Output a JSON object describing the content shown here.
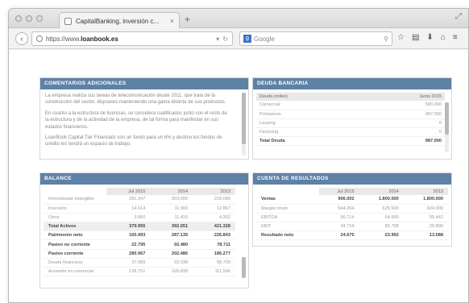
{
  "browser": {
    "tab_title": "CapitalBanking, inversión c...",
    "tab_close": "×",
    "new_tab": "+",
    "url_prefix": "https://www.",
    "url_domain": "loanbook.es",
    "reload": "↻",
    "search_placeholder": "Google",
    "search_engine_icon": "google-icon",
    "back_icon": "back-arrow-icon",
    "tool_icons": [
      "star-icon",
      "reading-list-icon",
      "download-icon",
      "home-icon",
      "menu-icon"
    ]
  },
  "panels": {
    "additional_comments": {
      "title": "COMENTARIOS ADICIONALES",
      "paragraphs": [
        "La empresa realiza sus tareas de telecomunicación desde 2011, que trata de la construcción del sector, dispuesto manteniendo una gama distinta de sus productos.",
        "En cuanto a la estructura de licencias, se considera cualificados junto con el resto de la estructura y de la actividad de la empresa, de tal forma para manifestar en sus estados financieros.",
        "LoanBook Capital Tier Financials son un fondo para un 6% y destino los fondos de crédito les tendrá un espacio de trabajo."
      ]
    },
    "bank_debt": {
      "title": "DEUDA BANCARIA",
      "columns": [
        "Deuda (miles)",
        "Junio 2015"
      ],
      "rows": [
        {
          "label": "Comercial",
          "value": "500.000",
          "bold": false
        },
        {
          "label": "Préstamos",
          "value": "487.000",
          "bold": false
        },
        {
          "label": "Leasing",
          "value": "0",
          "bold": false
        },
        {
          "label": "Factoring",
          "value": "0",
          "bold": false
        },
        {
          "label": "Total Deuda",
          "value": "987.000",
          "bold": true
        }
      ]
    },
    "balance": {
      "title": "BALANCE",
      "columns": [
        "Jul 2015",
        "2014",
        "2013"
      ],
      "rows": [
        {
          "label": "Inmovilizado intangible",
          "v": [
            "281.347",
            "303.000",
            "229.086"
          ],
          "bold": false,
          "hl": false
        },
        {
          "label": "Inversión",
          "v": [
            "14.614",
            "11.900",
            "12.867"
          ],
          "bold": false,
          "hl": false
        },
        {
          "label": "Otros",
          "v": [
            "3.950",
            "11.416",
            "4.262"
          ],
          "bold": false,
          "hl": false
        },
        {
          "label": "Total Activos",
          "v": "0",
          "vals": [
            "379.955",
            "392.051",
            "421.328"
          ],
          "bold": true,
          "hl": true
        },
        {
          "label": "Patrimonio neto",
          "vals": [
            "105.993",
            "287.135",
            "226.843"
          ],
          "bold": true,
          "hl": false
        },
        {
          "label": "Pasivo no corriente",
          "vals": [
            "22.795",
            "92.480",
            "78.711"
          ],
          "bold": true,
          "hl": false
        },
        {
          "label": "Pasivo corriente",
          "vals": [
            "280.967",
            "202.486",
            "186.277"
          ],
          "bold": true,
          "hl": false
        },
        {
          "label": "Deuda financiera",
          "vals": [
            "37.089",
            "93.038",
            "58.700"
          ],
          "bold": false,
          "hl": false
        },
        {
          "label": "Acreedor no comercial",
          "vals": [
            "128.751",
            "105.838",
            "111.506"
          ],
          "bold": false,
          "hl": false
        }
      ]
    },
    "income": {
      "title": "CUENTA DE RESULTADOS",
      "columns": [
        "Jul 2015",
        "2014",
        "2013"
      ],
      "rows": [
        {
          "label": "Ventas",
          "vals": [
            "906.002",
            "1.800.000",
            "1.800.000"
          ],
          "bold": true
        },
        {
          "label": "Margen bruto",
          "vals": [
            "544.264",
            "625.500",
            "624.000"
          ],
          "bold": false
        },
        {
          "label": "EBITDA",
          "vals": [
            "56.714",
            "64.999",
            "55.442"
          ],
          "bold": false
        },
        {
          "label": "EBIT",
          "vals": [
            "34.714",
            "85.798",
            "29.800"
          ],
          "bold": false
        },
        {
          "label": "Resultado neto",
          "vals": "x",
          "values": [
            "24.675",
            "23.992",
            "13.088"
          ],
          "bold": true
        }
      ]
    }
  }
}
